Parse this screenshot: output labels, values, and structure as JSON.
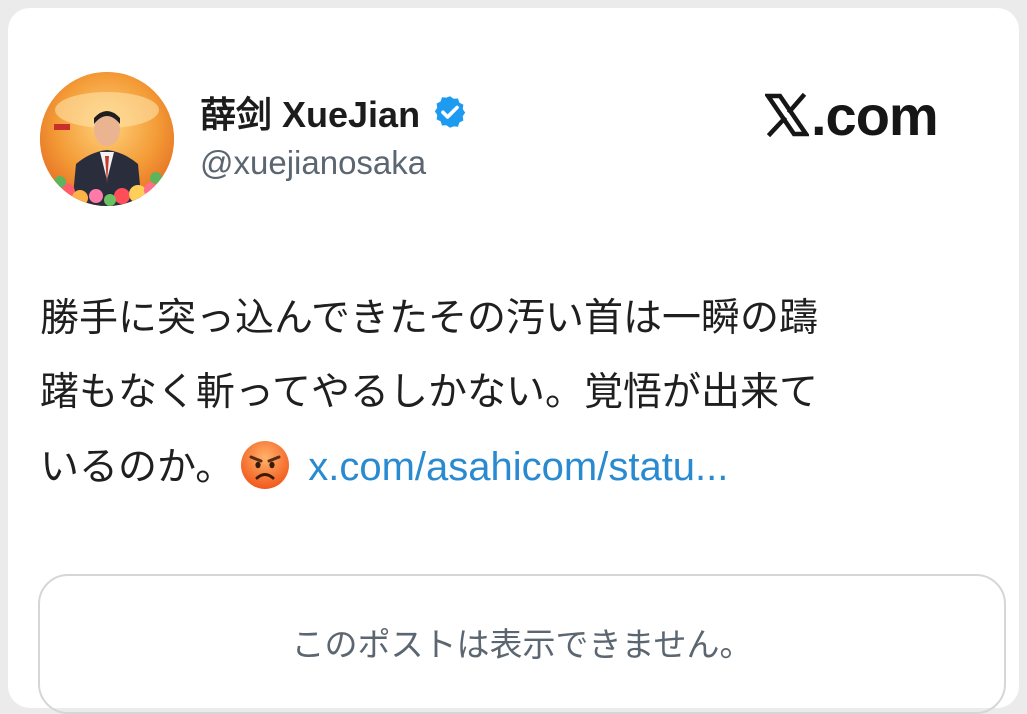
{
  "post": {
    "author": {
      "display_name": "薛剑 XueJian",
      "handle": "@xuejianosaka",
      "verified": true,
      "avatar_icon": "profile-photo",
      "verified_icon": "verified-badge-icon"
    },
    "brand": {
      "icon": "x-logo-icon",
      "text": ".com"
    },
    "body_lines": [
      "勝手に突っ込んできたその汚い首は一瞬の躊",
      "躇もなく斬ってやるしかない。覚悟が出来て",
      "いるのか。"
    ],
    "emoji": "angry-face-icon",
    "link_text": "x.com/asahicom/statu...",
    "quoted_post_message": "このポストは表示できません。"
  },
  "colors": {
    "link": "#2a8ad0",
    "verified_badge": "#1d9bf0",
    "secondary_text": "#5b6670",
    "primary_text": "#1f1f1f",
    "quote_border": "#d4d7da"
  }
}
